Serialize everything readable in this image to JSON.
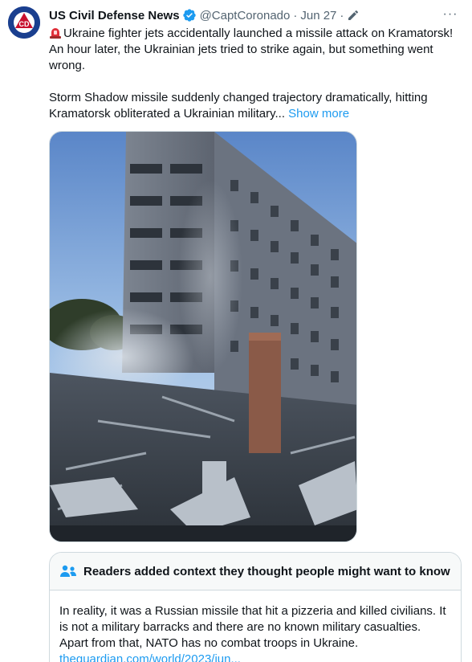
{
  "tweet": {
    "author_name": "US Civil Defense News",
    "handle": "@CaptCoronado",
    "separator": "·",
    "date": "Jun 27",
    "separator2": "·",
    "avatar_text": "CD",
    "more_label": "···",
    "text_line1": "Ukraine fighter jets accidentally launched a missile attack on Kramatorsk! An hour later, the Ukrainian jets tried to strike again, but something went wrong.",
    "text_line2": "Storm Shadow missile suddenly changed trajectory dramatically, hitting Kramatorsk obliterated a Ukrainian military...",
    "show_more": "Show more",
    "icons": {
      "avatar": "civil-defense-logo",
      "verified": "verified-badge-icon",
      "edit": "pencil-icon",
      "more": "more-icon",
      "siren": "siren-emoji-icon"
    },
    "colors": {
      "link": "#1d9bf0",
      "muted": "#536471",
      "verified": "#1d9bf0"
    }
  },
  "media": {
    "description_alt": "Video frame of destroyed building in Kramatorsk"
  },
  "community_note": {
    "heading": "Readers added context they thought people might want to know",
    "body": "In reality, it was a Russian missile that hit a pizzeria and killed civilians. It is not a military barracks and there are no known military casualties. Apart from that, NATO has no combat troops in Ukraine.",
    "link": "theguardian.com/world/2023/jun...",
    "icon": "people-icon"
  }
}
